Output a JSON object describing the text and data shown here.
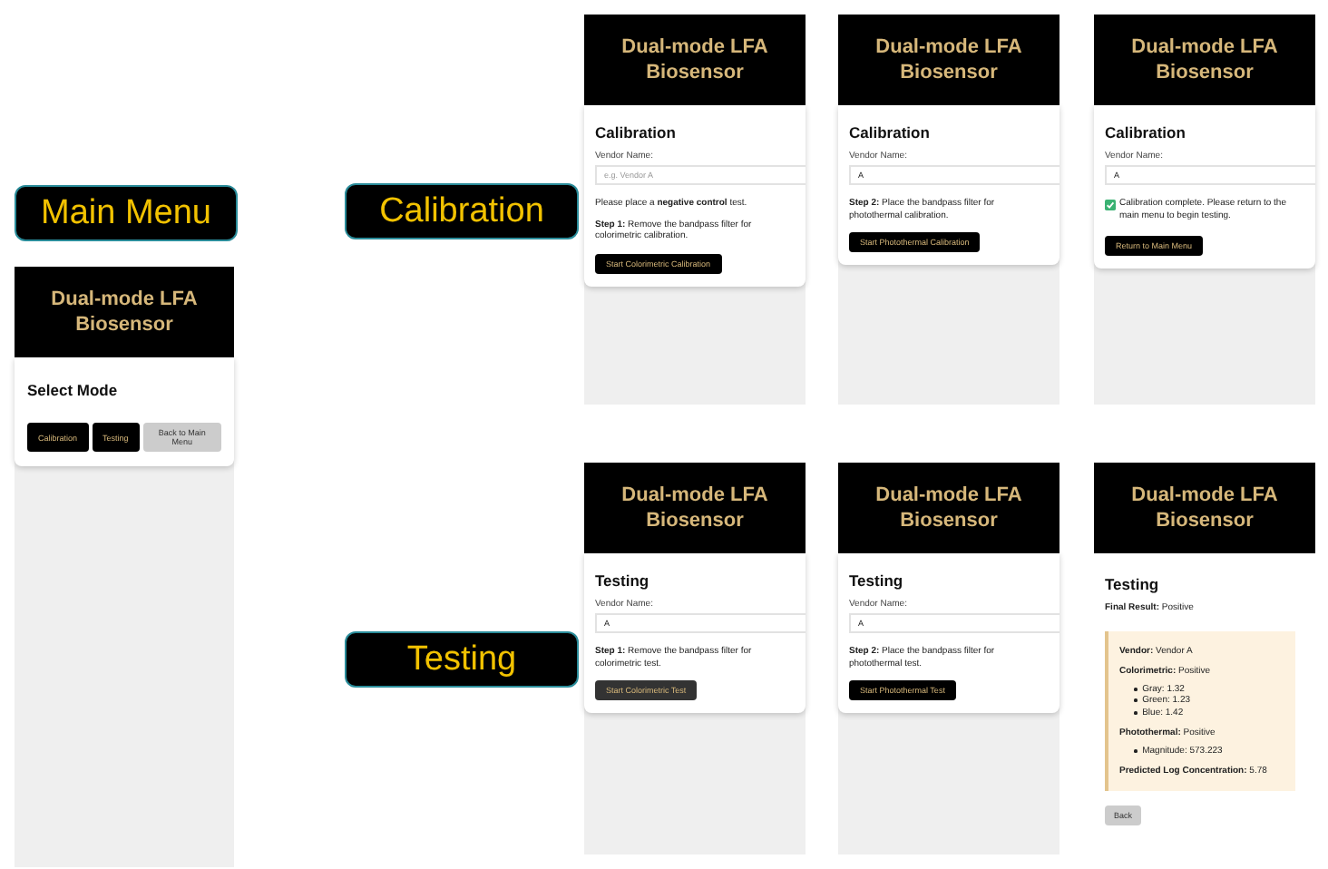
{
  "section_labels": [
    {
      "text": "Main Menu"
    },
    {
      "text": "Calibration"
    },
    {
      "text": "Testing"
    }
  ],
  "screens": [
    {
      "kind": "menu",
      "header": "Dual-mode LFA Biosensor",
      "title": "Select Mode",
      "buttons": [
        {
          "label": "Calibration",
          "kind": "primary"
        },
        {
          "label": "Testing",
          "kind": "primary"
        },
        {
          "label": "Back to Main Menu",
          "kind": "secondary"
        }
      ]
    },
    {
      "kind": "form",
      "header": "Dual-mode LFA Biosensor",
      "title": "Calibration",
      "vendor_label": "Vendor Name:",
      "vendor_field": {
        "placeholder": "e.g. Vendor A"
      },
      "notes": [
        "Please place a **negative control** test.",
        "**Step 1:** Remove the bandpass filter for colorimetric calibration."
      ],
      "button": {
        "label": "Start Colorimetric Calibration",
        "kind": "primary"
      }
    },
    {
      "kind": "form",
      "header": "Dual-mode LFA Biosensor",
      "title": "Calibration",
      "vendor_label": "Vendor Name:",
      "vendor_field": {
        "value": "A"
      },
      "notes": [
        "**Step 2:** Place the bandpass filter for photothermal calibration."
      ],
      "button": {
        "label": "Start Photothermal Calibration",
        "kind": "primary"
      }
    },
    {
      "kind": "form",
      "header": "Dual-mode LFA Biosensor",
      "title": "Calibration",
      "vendor_label": "Vendor Name:",
      "vendor_field": {
        "value": "A"
      },
      "message": {
        "text": "Calibration complete. Please return to the main menu to begin testing.",
        "checked": true
      },
      "button": {
        "label": "Return to Main Menu",
        "kind": "primary"
      }
    },
    {
      "kind": "form",
      "header": "Dual-mode LFA Biosensor",
      "title": "Testing",
      "vendor_label": "Vendor Name:",
      "vendor_field": {
        "value": "A"
      },
      "notes": [
        "**Step 1:** Remove the bandpass filter for colorimetric test."
      ],
      "button": {
        "label": "Start Colorimetric Test",
        "kind": "muted"
      }
    },
    {
      "kind": "form",
      "header": "Dual-mode LFA Biosensor",
      "title": "Testing",
      "vendor_label": "Vendor Name:",
      "vendor_field": {
        "value": "A"
      },
      "notes": [
        "**Step 2:** Place the bandpass filter for photothermal test."
      ],
      "button": {
        "label": "Start Photothermal Test",
        "kind": "primary"
      }
    },
    {
      "kind": "result",
      "header": "Dual-mode LFA Biosensor",
      "title": "Testing",
      "final_result": "**Final Result:** Positive",
      "report": [
        {
          "text": "**Vendor:** Vendor A"
        },
        {
          "text": "**Colorimetric:** Positive",
          "bullets": [
            "Gray: 1.32",
            "Green: 1.23",
            "Blue: 1.42"
          ]
        },
        {
          "text": "**Photothermal:** Positive",
          "bullets": [
            "Magnitude: 573.223"
          ]
        },
        {
          "text": "**Predicted Log Concentration:** 5.78"
        }
      ],
      "button": {
        "label": "Back",
        "kind": "secondary"
      }
    }
  ]
}
